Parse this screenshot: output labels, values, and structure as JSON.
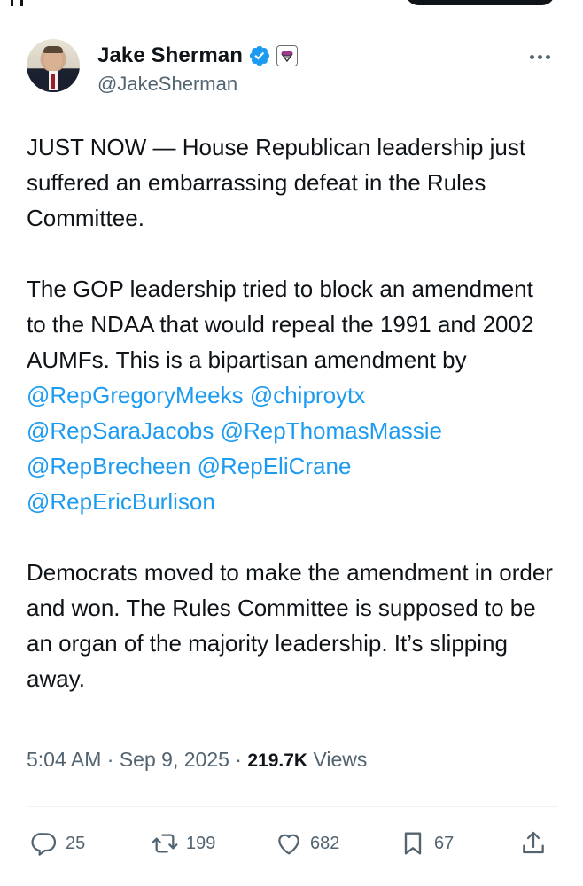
{
  "tweet": {
    "author": {
      "name": "Jake Sherman",
      "handle": "@JakeSherman",
      "verified_color": "#1d9bf0"
    },
    "paragraphs": {
      "p1": "JUST NOW — House Republican leadership just suffered an embarrassing defeat in the Rules Committee.",
      "p2_text": "The GOP leadership tried to block an amendment to the NDAA that would repeal the 1991 and 2002 AUMFs. This is a bipartisan amendment by",
      "mentions": [
        "@RepGregoryMeeks",
        "@chiproytx",
        "@RepSaraJacobs",
        "@RepThomasMassie",
        "@RepBrecheen",
        "@RepEliCrane",
        "@RepEricBurlison"
      ],
      "p3": "Democrats moved to make the amendment in order and won. The Rules Committee is supposed to be an organ of the majority leadership. It’s slipping away."
    },
    "meta": {
      "time": "5:04 AM",
      "separator": "·",
      "date": "Sep 9, 2025",
      "views_count": "219.7K",
      "views_label": "Views"
    },
    "actions": {
      "replies": "25",
      "reposts": "199",
      "likes": "682",
      "bookmarks": "67"
    },
    "icons": {
      "reply": "reply-icon",
      "repost": "repost-icon",
      "like": "heart-icon",
      "bookmark": "bookmark-icon",
      "share": "share-icon",
      "more": "more-icon",
      "verified": "verified-badge-icon",
      "affiliation": "affiliation-icon"
    },
    "colors": {
      "mention": "#1d9bf0",
      "secondary_text": "#536471",
      "primary_text": "#0f1419"
    }
  }
}
